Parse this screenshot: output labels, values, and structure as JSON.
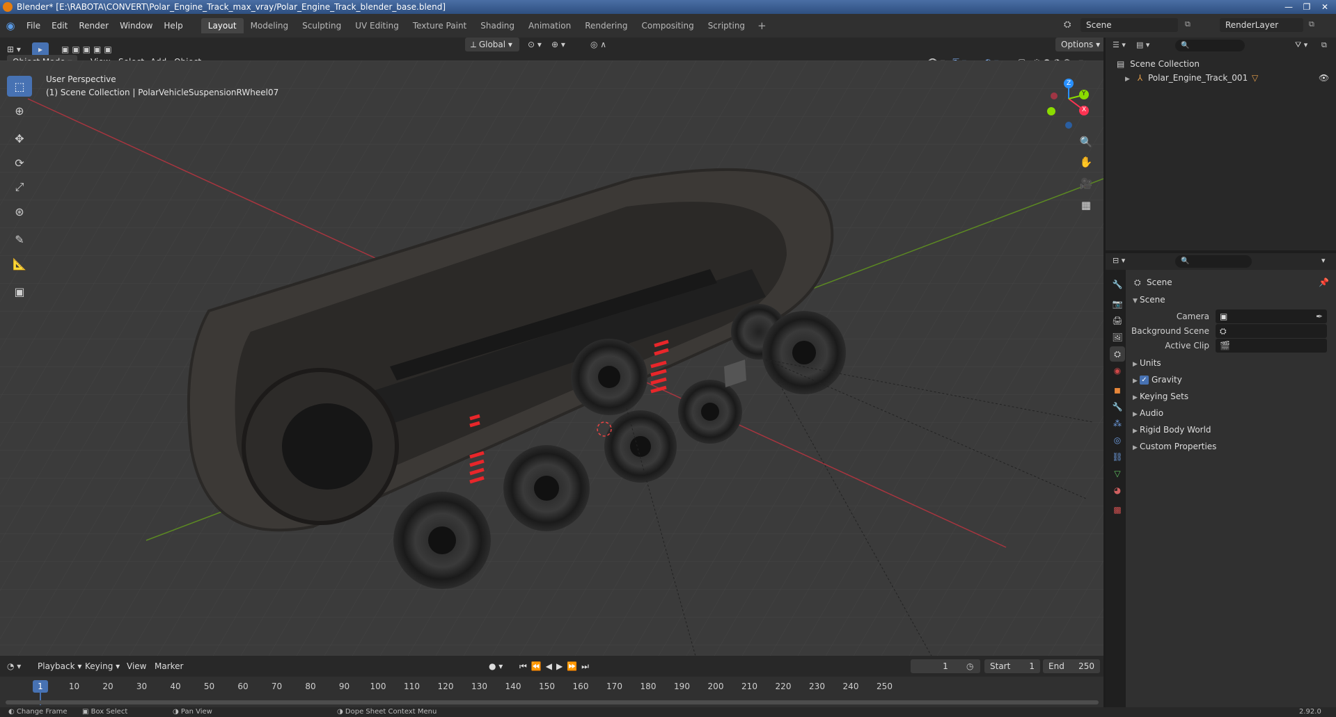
{
  "title": "Blender* [E:\\RABOTA\\CONVERT\\Polar_Engine_Track_max_vray/Polar_Engine_Track_blender_base.blend]",
  "menu": [
    "File",
    "Edit",
    "Render",
    "Window",
    "Help"
  ],
  "workspaces": [
    "Layout",
    "Modeling",
    "Sculpting",
    "UV Editing",
    "Texture Paint",
    "Shading",
    "Animation",
    "Rendering",
    "Compositing",
    "Scripting"
  ],
  "active_workspace": "Layout",
  "scene_name": "Scene",
  "render_layer": "RenderLayer",
  "viewport_header": {
    "mode": "Object Mode",
    "menus": [
      "View",
      "Select",
      "Add",
      "Object"
    ],
    "orientation": "Global",
    "options": "Options"
  },
  "viewport_info": {
    "perspective": "User Perspective",
    "collection": "(1) Scene Collection | PolarVehicleSuspensionRWheel07"
  },
  "gizmo_axes": {
    "z": "Z",
    "y": "Y",
    "x": "X"
  },
  "outliner": {
    "root": "Scene Collection",
    "items": [
      {
        "label": "Polar_Engine_Track_001"
      }
    ]
  },
  "properties": {
    "context": "Scene",
    "section": "Scene",
    "fields": [
      {
        "label": "Camera",
        "value": ""
      },
      {
        "label": "Background Scene",
        "value": ""
      },
      {
        "label": "Active Clip",
        "value": ""
      }
    ],
    "subsections": [
      "Units",
      "Gravity",
      "Keying Sets",
      "Audio",
      "Rigid Body World",
      "Custom Properties"
    ],
    "gravity_enabled": true
  },
  "timeline": {
    "menus": [
      "Playback",
      "Keying",
      "View",
      "Marker"
    ],
    "current_frame": "1",
    "start_label": "Start",
    "start": "1",
    "end_label": "End",
    "end": "250",
    "ticks": [
      "10",
      "20",
      "30",
      "40",
      "50",
      "60",
      "70",
      "80",
      "90",
      "100",
      "110",
      "120",
      "130",
      "140",
      "150",
      "160",
      "170",
      "180",
      "190",
      "200",
      "210",
      "220",
      "230",
      "240",
      "250"
    ]
  },
  "statusbar": {
    "items": [
      "Change Frame",
      "Box Select",
      "Pan View",
      "Dope Sheet Context Menu"
    ],
    "version": "2.92.0"
  },
  "colors": {
    "accent": "#4772b3",
    "axis_x": "#ff3352",
    "axis_y": "#8bdc00",
    "axis_z": "#2890ff",
    "spring": "#e8262a"
  }
}
